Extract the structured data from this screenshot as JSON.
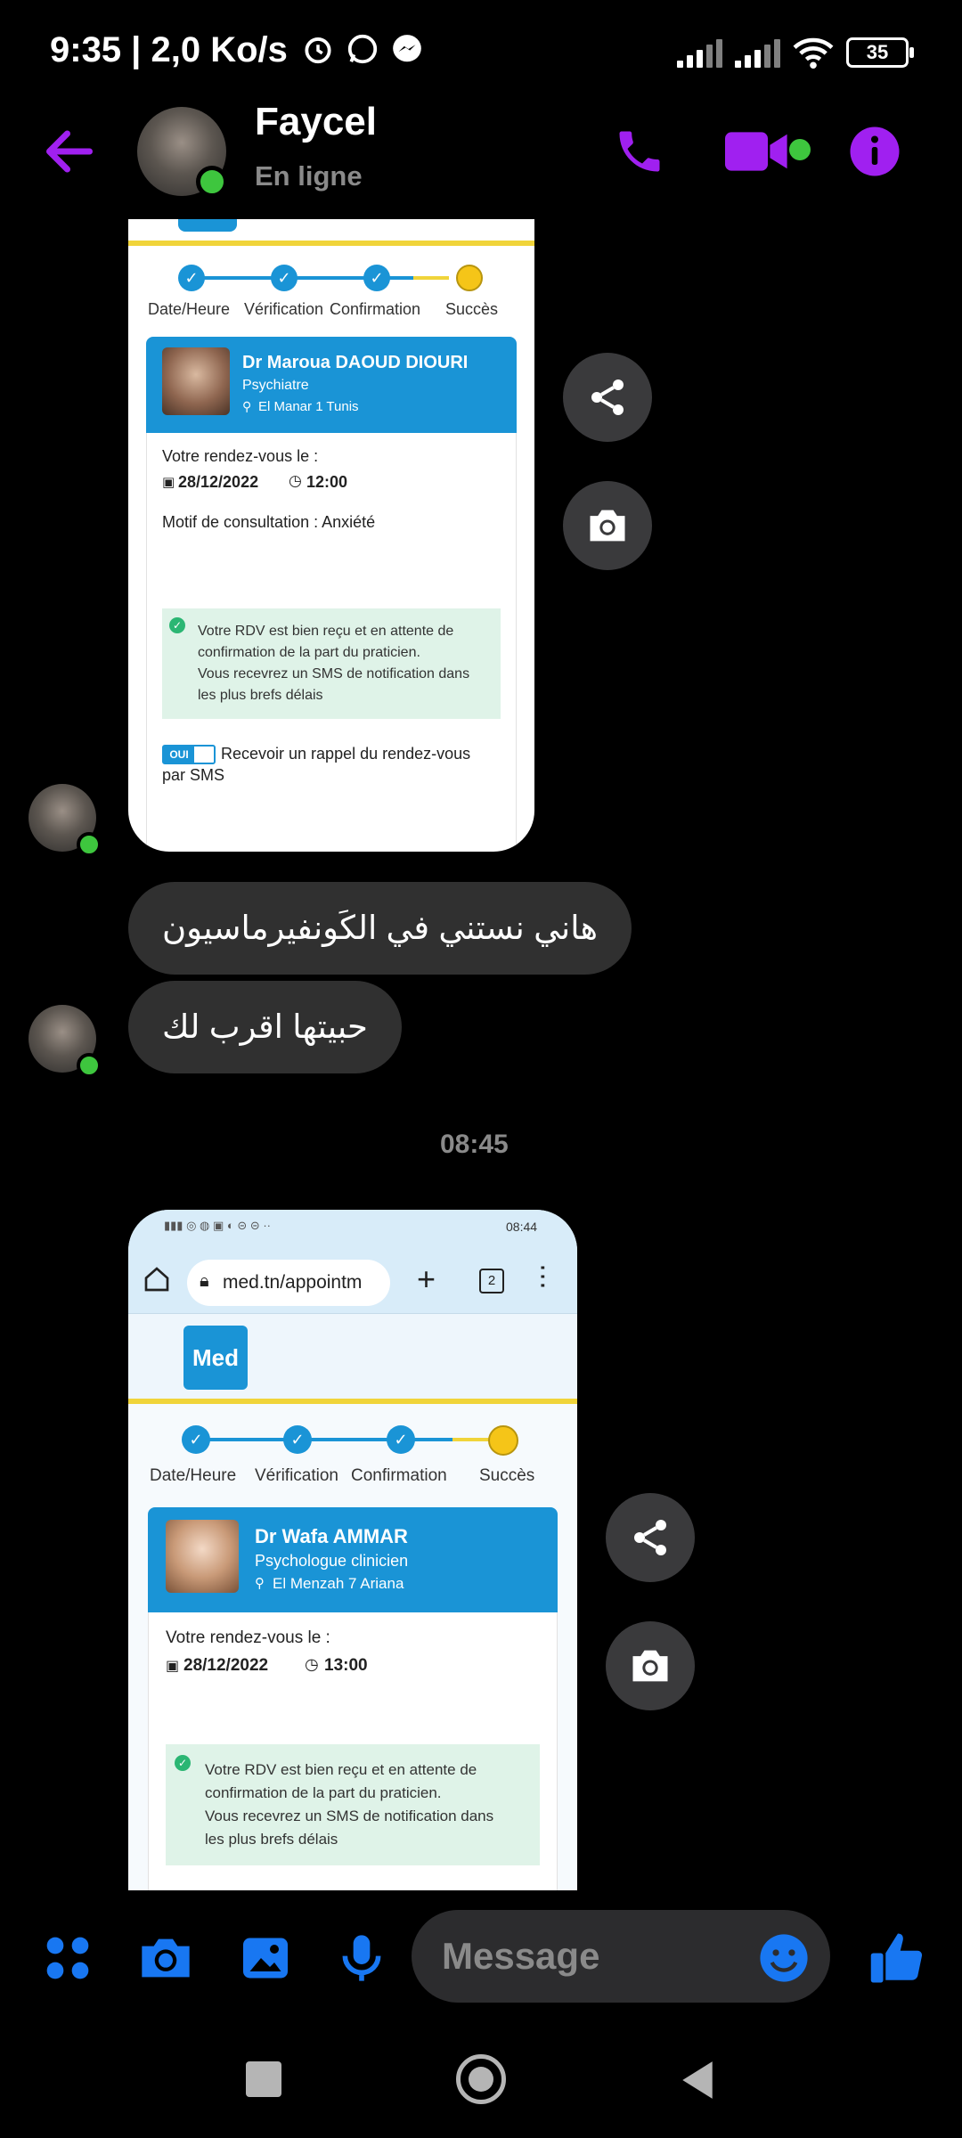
{
  "status_bar": {
    "time": "9:35 | 2,0 Ko/s",
    "battery": "35"
  },
  "header": {
    "name": "Faycel",
    "status": "En ligne"
  },
  "colors": {
    "accent": "#a020f0",
    "blue": "#1877f2",
    "online": "#3ec63e"
  },
  "card1": {
    "steps": [
      "Date/Heure",
      "Vérification",
      "Confirmation",
      "Succès"
    ],
    "doctor_name": "Dr Maroua DAOUD DIOURI",
    "specialty": "Psychiatre",
    "location": "El Manar 1 Tunis",
    "rdv_label": "Votre rendez-vous le :",
    "date": "28/12/2022",
    "time": "12:00",
    "motif": "Motif de consultation : Anxiété",
    "notice_line1": "Votre RDV est bien reçu et en attente de",
    "notice_line2": "confirmation de la part du praticien.",
    "notice_line3": "Vous recevrez un SMS de notification dans",
    "notice_line4": "les plus brefs délais",
    "toggle": "OUI",
    "reminder_line1": "Recevoir un rappel du rendez-vous",
    "reminder_line2": "par SMS"
  },
  "messages": [
    "هاني نستني في الكَونفيرماسيون",
    "حبيتها اقرب لك"
  ],
  "timestamp": "08:45",
  "card2": {
    "phone_status_time": "08:44",
    "url": "med.tn/appointm",
    "tab_count": "2",
    "logo": "Med",
    "steps": [
      "Date/Heure",
      "Vérification",
      "Confirmation",
      "Succès"
    ],
    "doctor_name": "Dr Wafa AMMAR",
    "specialty": "Psychologue clinicien",
    "location": "El Menzah 7 Ariana",
    "rdv_label": "Votre rendez-vous le :",
    "date": "28/12/2022",
    "time": "13:00",
    "notice_line1": "Votre RDV est bien reçu et en attente de",
    "notice_line2": "confirmation de la part du praticien.",
    "notice_line3": "Vous recevrez un SMS de notification dans",
    "notice_line4": "les plus brefs délais"
  },
  "composer": {
    "placeholder": "Message"
  }
}
